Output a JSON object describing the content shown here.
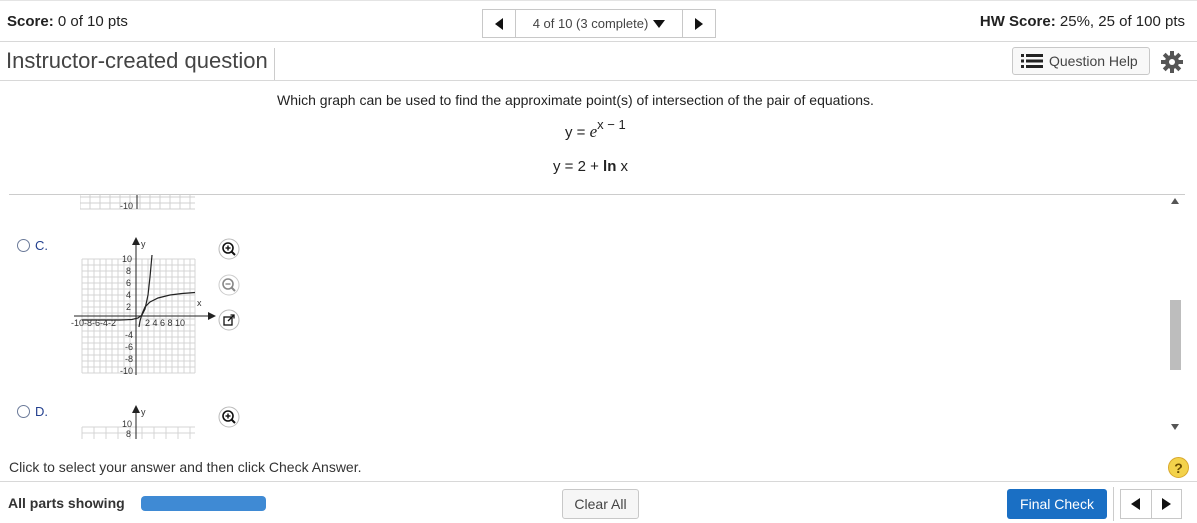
{
  "header": {
    "score_label": "Score:",
    "score_value": "0 of 10 pts",
    "question_counter": "4 of 10 (3 complete)",
    "hw_score_label": "HW Score:",
    "hw_score_value": "25%, 25 of 100 pts"
  },
  "question": {
    "title": "Instructor-created question",
    "help_label": "Question Help",
    "prompt": "Which graph can be used to find the approximate point(s) of intersection of the pair of equations.",
    "eq1_lhs": "y = ",
    "eq1_base": "e",
    "eq1_exp": "x − 1",
    "eq2_lhs": "y = 2  +  ",
    "eq2_ln": "ln",
    "eq2_var": " x"
  },
  "options": [
    {
      "label": "C."
    },
    {
      "label": "D."
    }
  ],
  "graph": {
    "y_axis_label": "y",
    "x_axis_label": "x",
    "top_partial_tick": "-10",
    "y_ticks": [
      "10",
      "8",
      "6",
      "4",
      "2",
      "-4",
      "-6",
      "-8",
      "-10"
    ],
    "x_ticks_left": "-10-8-6-4-2",
    "x_ticks_right": "2  4  6  8 10",
    "d_ticks": [
      "10",
      "8"
    ]
  },
  "footer": {
    "instruction": "Click to select your answer and then click Check Answer.",
    "help_symbol": "?",
    "parts_label": "All parts showing",
    "clear_all_label": "Clear All",
    "final_check_label": "Final Check"
  },
  "progress_fraction": 1.0
}
